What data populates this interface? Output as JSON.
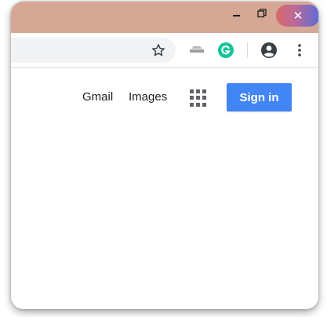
{
  "window_controls": {
    "minimize_icon": "minimize-icon",
    "restore_icon": "restore-icon",
    "close_icon": "close-icon",
    "close_glyph": "✕"
  },
  "toolbar": {
    "star_icon": "star-icon",
    "extension_icon": "extension-icon",
    "grammarly_icon": "grammarly-icon",
    "profile_icon": "profile-icon",
    "menu_icon": "kebab-menu-icon"
  },
  "header": {
    "gmail_label": "Gmail",
    "images_label": "Images",
    "apps_icon": "apps-grid-icon",
    "sign_in_label": "Sign in"
  },
  "colors": {
    "titlebar": "#d4a895",
    "sign_in_button": "#4285f4",
    "grammarly": "#15c39a"
  }
}
